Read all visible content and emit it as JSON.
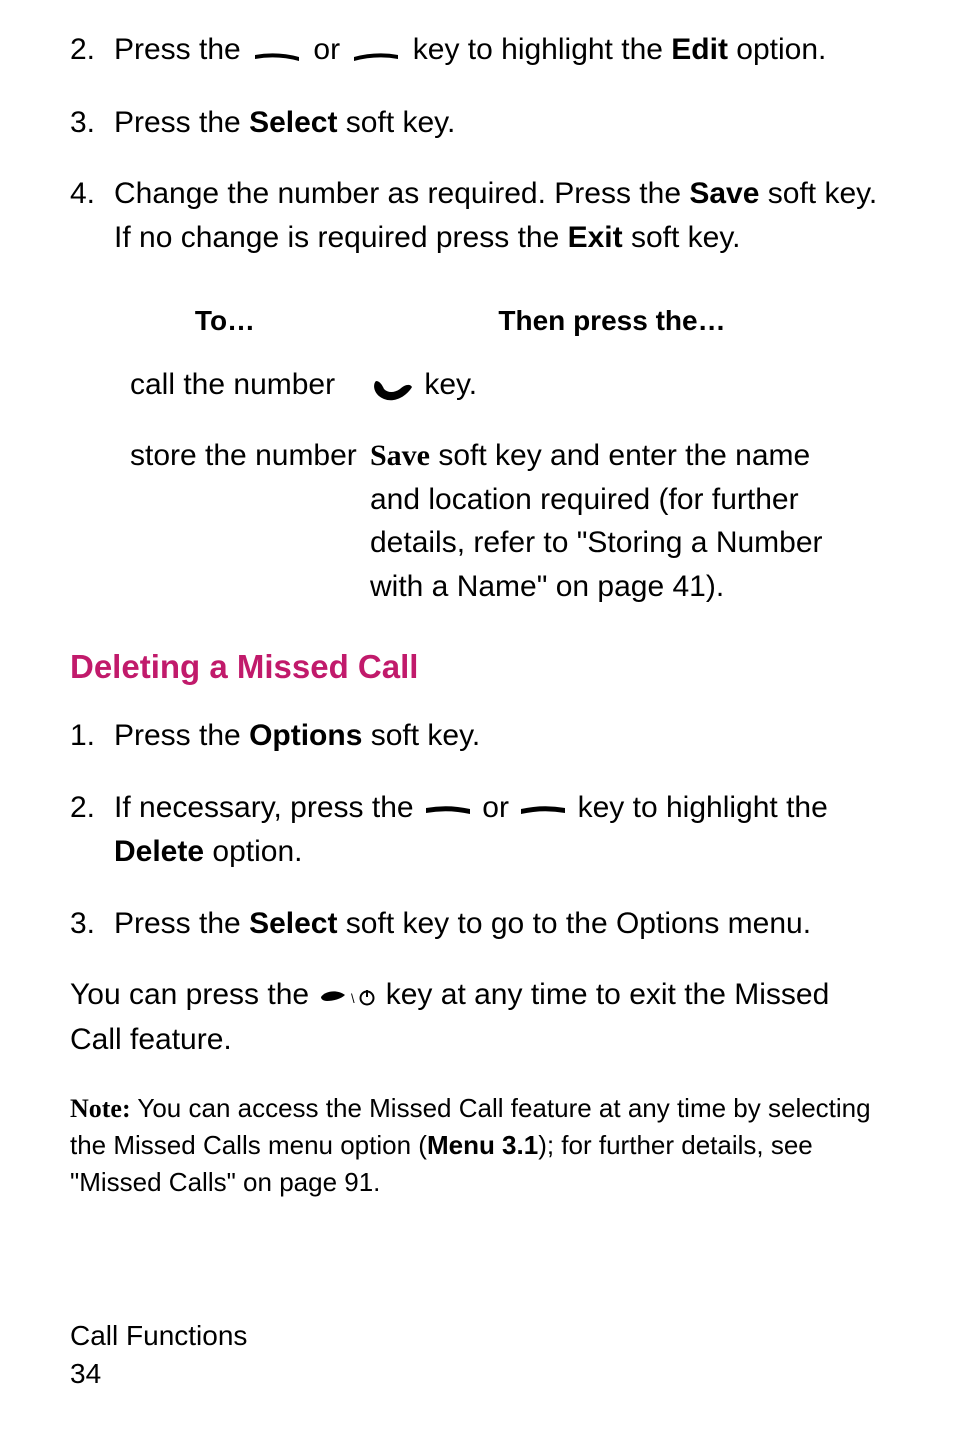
{
  "steps_top": [
    {
      "num": "2.",
      "pre": "Press the ",
      "mid": " or ",
      "post_a": " key to highlight the ",
      "bold": "Edit",
      "post_b": " option."
    },
    {
      "num": "3.",
      "text_a": "Press the ",
      "bold": "Select",
      "text_b": " soft key."
    },
    {
      "num": "4.",
      "text_a": "Change the number as required. Press the ",
      "bold_a": "Save",
      "text_b": " soft key. If no change is required press the ",
      "bold_b": "Exit",
      "text_c": " soft key."
    }
  ],
  "table": {
    "head_left": "To…",
    "head_right": "Then press the…",
    "rows": [
      {
        "left": "call the number",
        "right_after_icon": " key."
      },
      {
        "left": "store the number",
        "save_label": "Save",
        "right_rest": " soft key and enter the name and location required (for further details, refer to \"Storing a Number with a Name\" on page 41)."
      }
    ]
  },
  "heading": "Deleting a Missed Call",
  "del_steps": [
    {
      "num": "1.",
      "text_a": "Press the ",
      "bold": "Options",
      "text_b": " soft key."
    },
    {
      "num": "2.",
      "text_a": "If necessary, press the ",
      "mid": " or ",
      "text_b": " key to highlight the ",
      "bold": "Delete",
      "text_c": " option."
    },
    {
      "num": "3.",
      "text_a": "Press the ",
      "bold": "Select",
      "text_b": " soft key to go to the Options menu."
    }
  ],
  "para": {
    "a": "You can press the ",
    "b": " key at any time to exit the Missed Call feature."
  },
  "note": {
    "label": "Note:",
    "a": " You can access the Missed Call feature at any time by selecting the Missed Calls menu option (",
    "bold": "Menu 3.1",
    "b": "); for further details, see \"Missed Calls\" on page 91."
  },
  "footer": {
    "title": "Call Functions",
    "page": " 34"
  }
}
